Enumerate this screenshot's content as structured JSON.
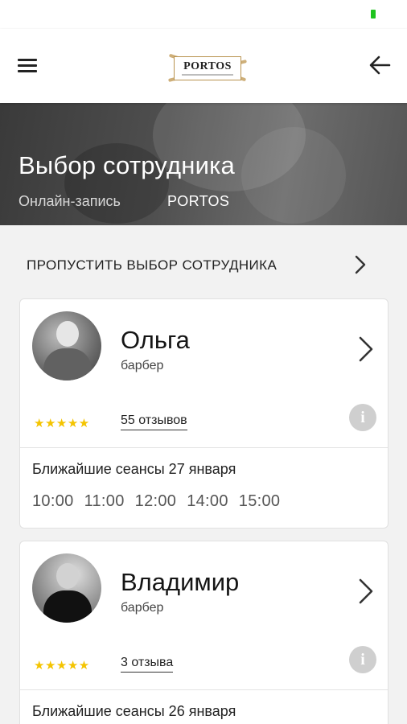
{
  "header": {
    "logo_text": "PORTOS",
    "menu_icon": "hamburger-icon",
    "back_icon": "arrow-left-icon"
  },
  "hero": {
    "title": "Выбор сотрудника",
    "breadcrumb": [
      "Онлайн-запись",
      "PORTOS"
    ]
  },
  "skip": {
    "label": "ПРОПУСТИТЬ ВЫБОР СОТРУДНИКА"
  },
  "employees": [
    {
      "name": "Ольга",
      "role": "барбер",
      "rating_stars": "★★★★★",
      "rating": 5,
      "reviews": "55 отзывов",
      "sessions_title": "Ближайшие сеансы 27 января",
      "slots": [
        "10:00",
        "11:00",
        "12:00",
        "14:00",
        "15:00"
      ]
    },
    {
      "name": "Владимир",
      "role": "барбер",
      "rating_stars": "★★★★★",
      "rating": 5,
      "reviews": "3 отзыва",
      "sessions_title": "Ближайшие сеансы 26 января",
      "slots": []
    }
  ],
  "colors": {
    "status_indicator": "#1fc41f",
    "stars": "#f4c400",
    "logo_accent": "#c9a66a"
  }
}
